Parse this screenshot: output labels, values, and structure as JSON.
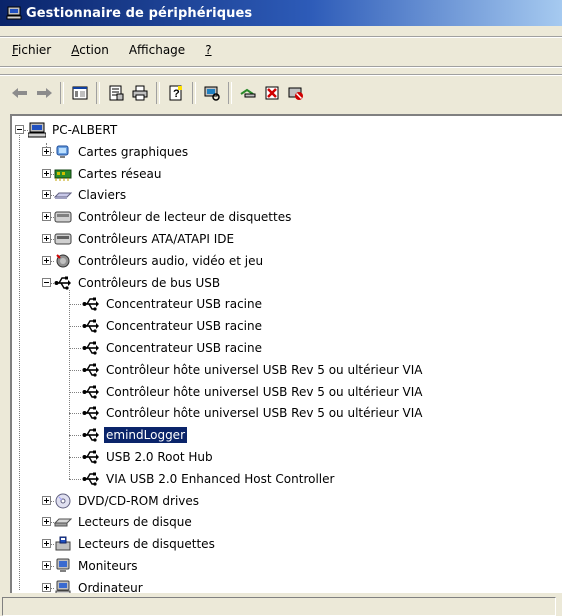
{
  "window": {
    "title": "Gestionnaire de périphériques"
  },
  "menu": [
    {
      "pre": "",
      "ul": "F",
      "post": "ichier"
    },
    {
      "pre": "",
      "ul": "A",
      "post": "ction"
    },
    {
      "pre": "Aff",
      "ul": "i",
      "post": "chage"
    },
    {
      "pre": "",
      "ul": "?",
      "post": ""
    }
  ],
  "toolbar": {
    "icons": [
      "back-arrow-icon",
      "forward-arrow-icon",
      "console-tree-icon",
      "properties-icon",
      "print-icon",
      "help-icon",
      "scan-hardware-icon",
      "update-driver-icon",
      "uninstall-icon",
      "disable-icon"
    ]
  },
  "tree": {
    "root": "PC-ALBERT",
    "categories": [
      {
        "label": "Cartes graphiques",
        "icon": "display-adapter-icon",
        "expanded": false
      },
      {
        "label": "Cartes réseau",
        "icon": "network-card-icon",
        "expanded": false
      },
      {
        "label": "Claviers",
        "icon": "keyboard-icon",
        "expanded": false
      },
      {
        "label": "Contrôleur de lecteur de disquettes",
        "icon": "floppy-controller-icon",
        "expanded": false
      },
      {
        "label": "Contrôleurs ATA/ATAPI IDE",
        "icon": "ide-controller-icon",
        "expanded": false
      },
      {
        "label": "Contrôleurs audio, vidéo et jeu",
        "icon": "audio-icon",
        "expanded": false
      },
      {
        "label": "Contrôleurs de bus USB",
        "icon": "usb-icon",
        "expanded": true,
        "children": [
          "Concentrateur USB racine",
          "Concentrateur USB racine",
          "Concentrateur USB racine",
          "Contrôleur hôte universel USB Rev 5 ou  ultérieur VIA",
          "Contrôleur hôte universel USB Rev 5 ou  ultérieur VIA",
          "Contrôleur hôte universel USB Rev 5 ou  ultérieur VIA",
          "emindLogger",
          "USB 2.0 Root Hub",
          "VIA USB 2.0 Enhanced Host Controller"
        ],
        "selected_child": "emindLogger"
      },
      {
        "label": "DVD/CD-ROM drives",
        "icon": "cdrom-icon",
        "expanded": false
      },
      {
        "label": "Lecteurs de disque",
        "icon": "disk-drive-icon",
        "expanded": false
      },
      {
        "label": "Lecteurs de disquettes",
        "icon": "floppy-drive-icon",
        "expanded": false
      },
      {
        "label": "Moniteurs",
        "icon": "monitor-icon",
        "expanded": false
      },
      {
        "label": "Ordinateur",
        "icon": "computer-icon",
        "expanded": false
      }
    ]
  },
  "colors": {
    "selection": "#0a246a",
    "titlebar_start": "#0a246a",
    "titlebar_end": "#a6caf0"
  }
}
